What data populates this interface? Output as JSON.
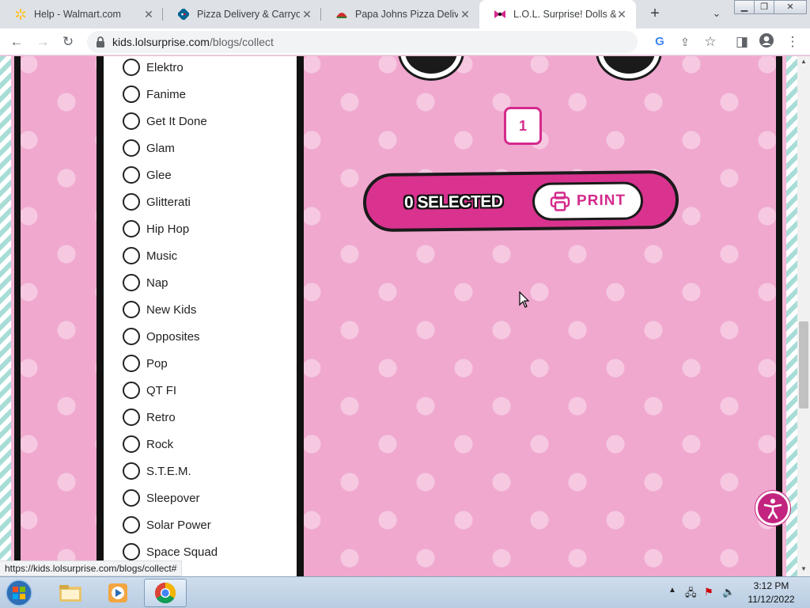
{
  "browser": {
    "tabs": [
      {
        "title": "Help - Walmart.com",
        "icon": "walmart-spark-icon",
        "color": "#ffc220"
      },
      {
        "title": "Pizza Delivery & Carryout",
        "icon": "dominos-icon",
        "color": "#006491"
      },
      {
        "title": "Papa Johns Pizza Delivery",
        "icon": "papa-johns-icon",
        "color": "#cf2e2e"
      },
      {
        "title": "L.O.L. Surprise! Dolls & Cl",
        "icon": "lol-bow-icon",
        "color": "#d42a8c",
        "active": true
      }
    ],
    "url_host": "kids.lolsurprise.com",
    "url_path": "/blogs/collect",
    "status_url": "https://kids.lolsurprise.com/blogs/collect#"
  },
  "filters": {
    "items": [
      "Elektro",
      "Fanime",
      "Get It Done",
      "Glam",
      "Glee",
      "Glitterati",
      "Hip Hop",
      "Music",
      "Nap",
      "New Kids",
      "Opposites",
      "Pop",
      "QT FI",
      "Retro",
      "Rock",
      "S.T.E.M.",
      "Sleepover",
      "Solar Power",
      "Space Squad"
    ]
  },
  "collection": {
    "page_number": "1",
    "selected_text": "0 SELECTED",
    "print_label": "PRINT"
  },
  "colors": {
    "accent": "#d42a8c",
    "pink_bg": "#f0a8cf",
    "mint_stripe": "#a8ddd7"
  },
  "taskbar": {
    "time": "3:12 PM",
    "date": "11/12/2022"
  }
}
